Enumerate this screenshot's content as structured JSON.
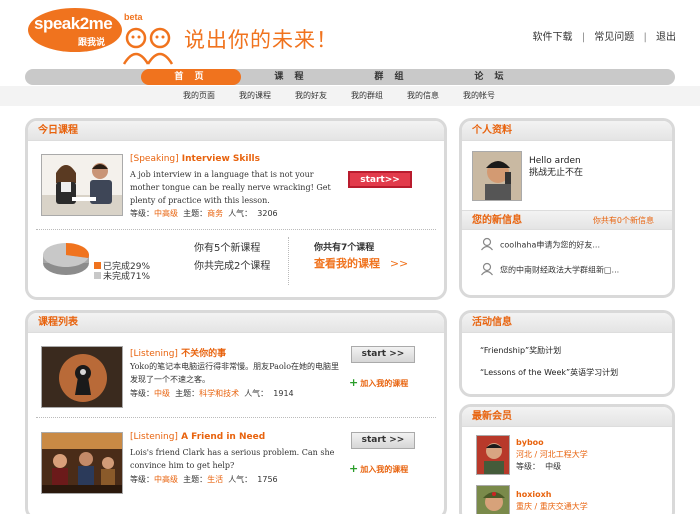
{
  "header": {
    "logo_text": "speak2me",
    "logo_sub": "跟我说",
    "logo_beta": "beta",
    "slogan": "说出你的未来！",
    "links": [
      "软件下载",
      "常见问题",
      "退出"
    ],
    "separator": "|"
  },
  "nav": {
    "items": [
      "首 页",
      "课 程",
      "群 组",
      "论 坛"
    ],
    "active_index": 0,
    "sub_items": [
      "我的页面",
      "我的课程",
      "我的好友",
      "我的群组",
      "我的信息",
      "我的帐号"
    ]
  },
  "today": {
    "heading": "今日课程",
    "course": {
      "tag": "[Speaking]",
      "title": "Interview Skills",
      "desc": "A job interview in a language that is not your mother tongue can be really nerve wracking! Get plenty of practice with this lesson.",
      "level_label": "等级：",
      "level": "中高级",
      "topic_label": "主题：",
      "topic": "商务",
      "pop_label": "人气：",
      "pop": "3206",
      "start": "start>>"
    },
    "progress": {
      "done_label": "已完成29%",
      "undone_label": "未完成71%",
      "done_fraction": 0.29,
      "new_courses": "你有5个新课程",
      "completed": "你共完成2个课程",
      "total": "你共有7个课程",
      "view_link": "查看我的课程",
      "arrows": ">>",
      "done_color": "#f0731e",
      "undone_color": "#c8c8c8"
    }
  },
  "course_list": {
    "heading": "课程列表",
    "items": [
      {
        "tag": "[Listening]",
        "title": "不关你的事",
        "desc": "Yoko的笔记本电脑运行得非常慢。朋友Paolo在她的电脑里发现了一个不速之客。",
        "level_label": "等级：",
        "level": "中级",
        "topic_label": "主题：",
        "topic": "科学和技术",
        "pop_label": "人气：",
        "pop": "1914",
        "start": "start >>",
        "add": "加入我的课程"
      },
      {
        "tag": "[Listening]",
        "title": "A Friend in Need",
        "desc": "Lois's friend Clark has a serious problem. Can she convince him to get help?",
        "level_label": "等级：",
        "level": "中高级",
        "topic_label": "主题：",
        "topic": "生活",
        "pop_label": "人气：",
        "pop": "1756",
        "start": "start >>",
        "add": "加入我的课程"
      }
    ]
  },
  "profile": {
    "heading": "个人资料",
    "greeting": "Hello arden",
    "status": "挑战无止不在"
  },
  "messages": {
    "heading": "您的新信息",
    "count_text": "你共有0个新信息",
    "items": [
      "coolhaha申请为您的好友...",
      "您的中南财经政法大学群组新□..."
    ]
  },
  "activities": {
    "heading": "活动信息",
    "items": [
      "“Friendship”奖励计划",
      "“Lessons of the Week”英语学习计划"
    ]
  },
  "members": {
    "heading": "最新会员",
    "items": [
      {
        "name": "byboo",
        "location": "河北 / 河北工程大学",
        "level_label": "等级：",
        "level": "中级"
      },
      {
        "name": "hoxioxh",
        "location": "重庆 / 重庆交通大学"
      }
    ]
  }
}
